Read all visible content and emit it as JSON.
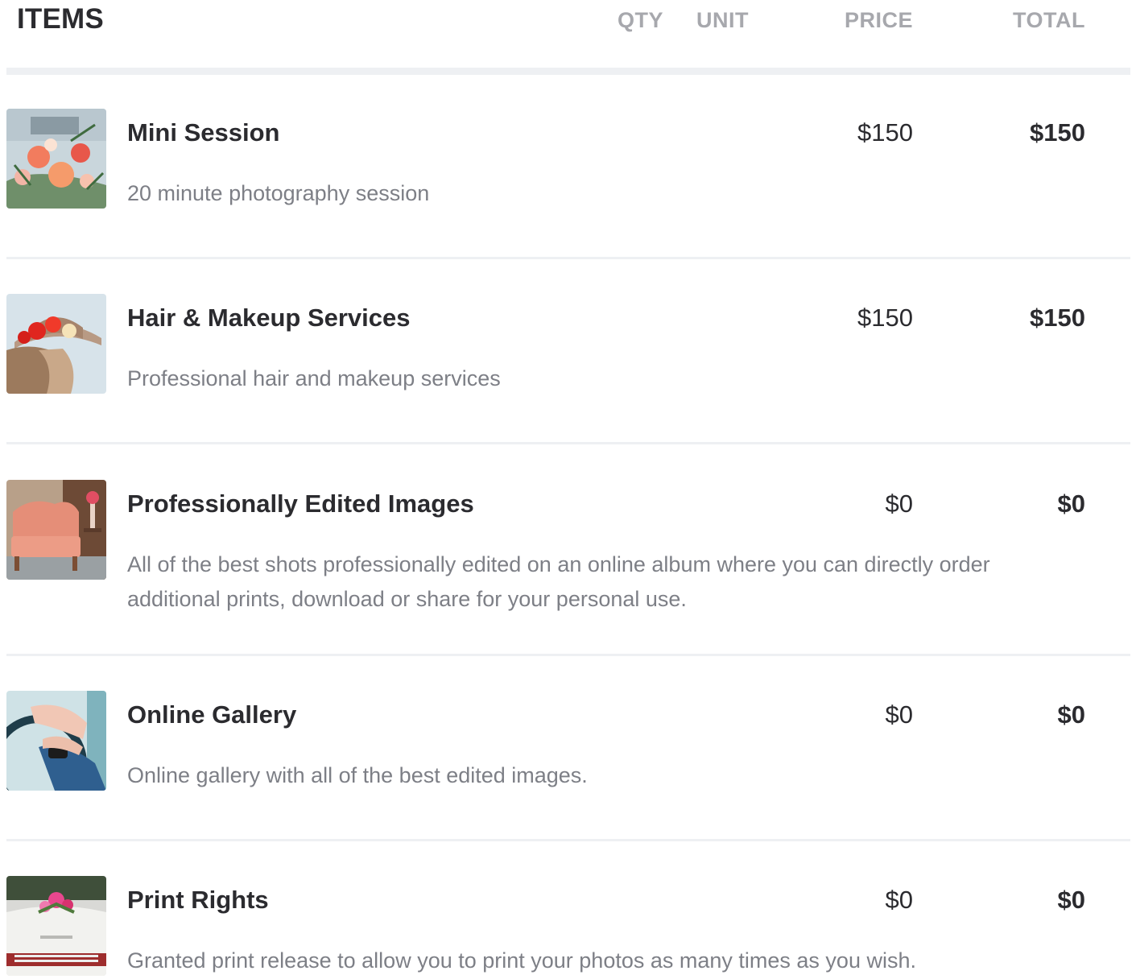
{
  "header": {
    "items_label": "ITEMS",
    "qty_label": "QTY",
    "unit_label": "UNIT",
    "price_label": "PRICE",
    "total_label": "TOTAL"
  },
  "items": [
    {
      "name": "Mini Session",
      "description": "20 minute photography session",
      "price": "$150",
      "total": "$150",
      "thumbnail_icon": "flower-bouquet-photo"
    },
    {
      "name": "Hair & Makeup Services",
      "description": "Professional hair and makeup services",
      "price": "$150",
      "total": "$150",
      "thumbnail_icon": "flower-hat-photo"
    },
    {
      "name": "Professionally Edited Images",
      "description": "All of the best shots professionally edited on an online album where you can directly order additional prints, download or share for your personal use.",
      "price": "$0",
      "total": "$0",
      "thumbnail_icon": "vintage-chair-photo"
    },
    {
      "name": "Online Gallery",
      "description": "Online gallery with all of the best edited images.",
      "price": "$0",
      "total": "$0",
      "thumbnail_icon": "hands-steering-wheel-photo"
    },
    {
      "name": "Print Rights",
      "description": "Granted print release to allow you to print your photos as many times as you wish.",
      "price": "$0",
      "total": "$0",
      "thumbnail_icon": "car-hood-flowers-photo"
    }
  ]
}
